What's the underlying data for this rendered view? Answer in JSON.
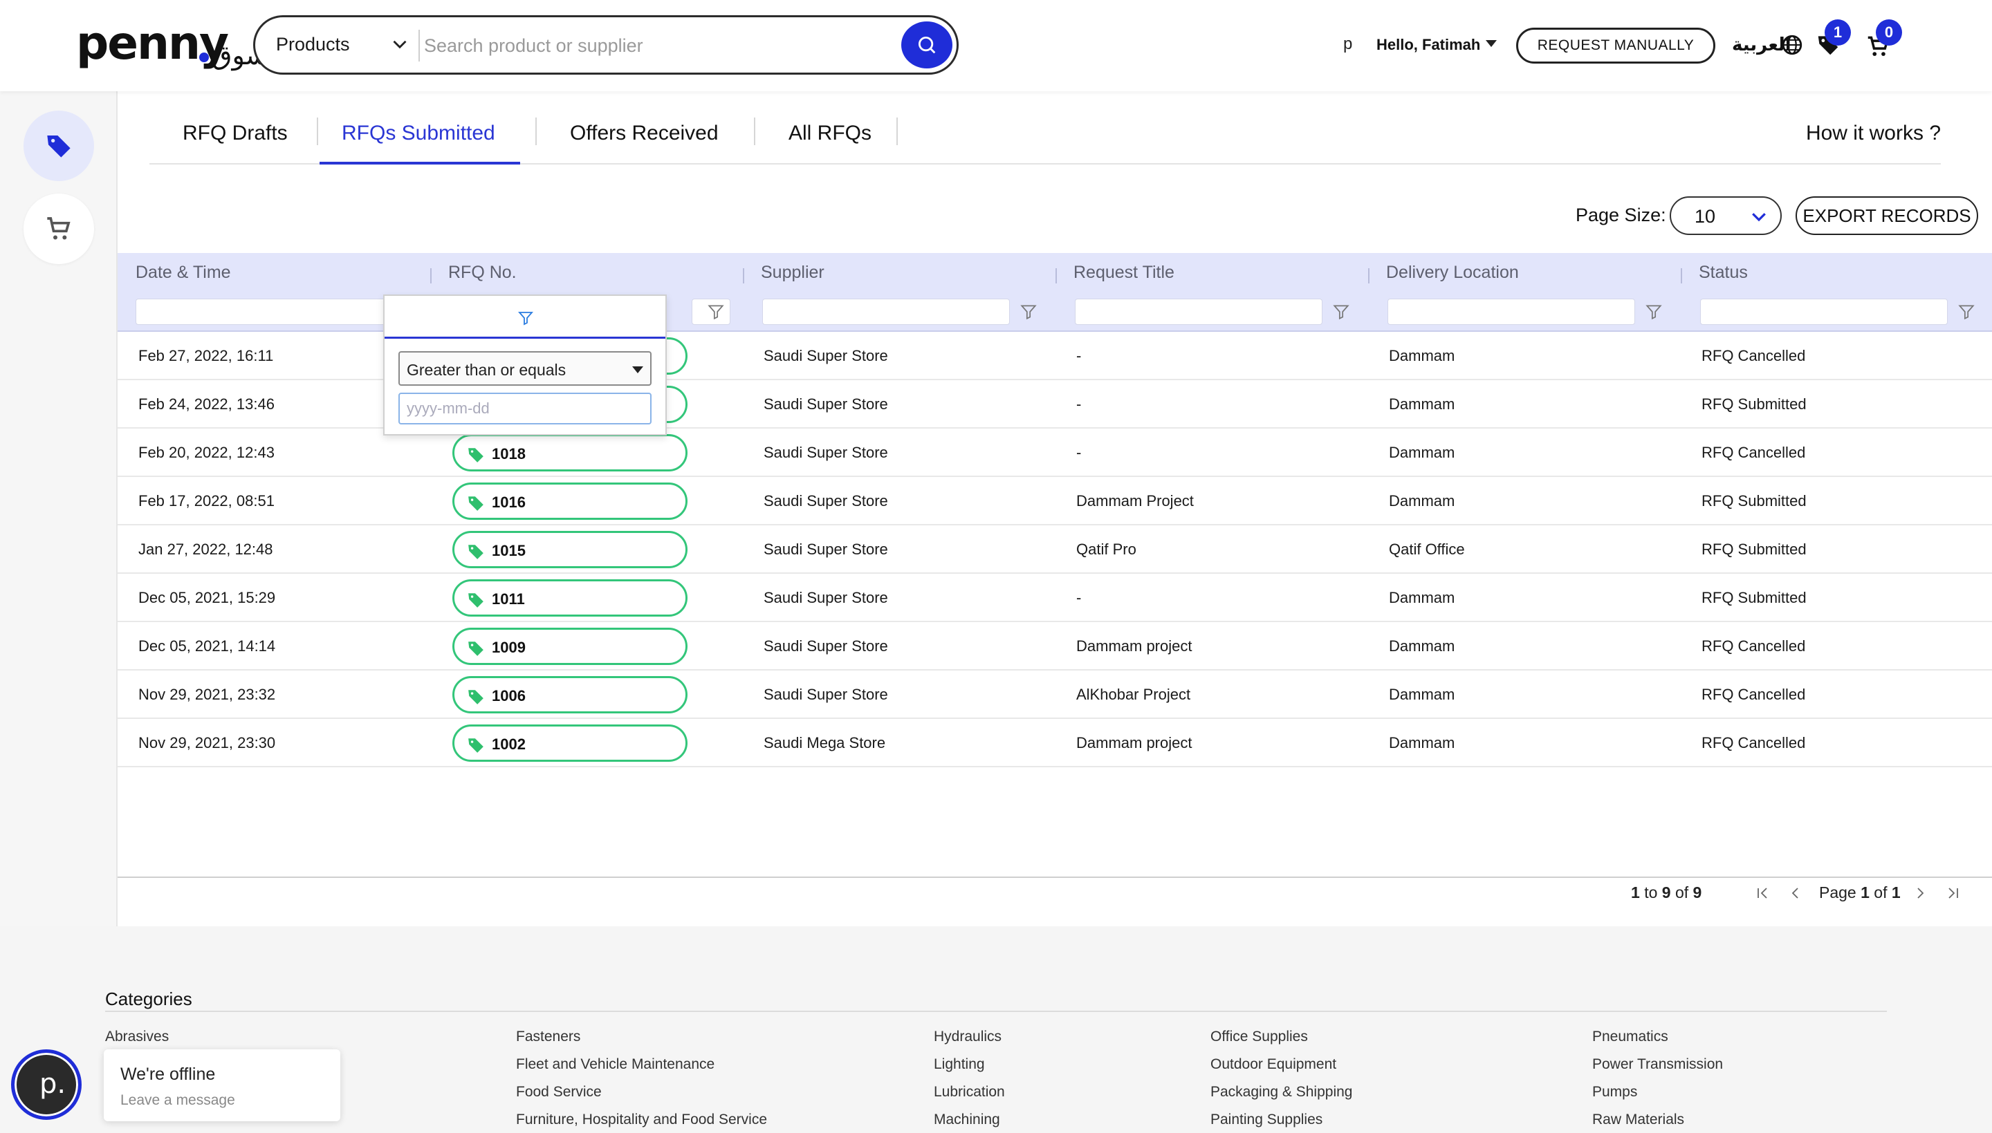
{
  "header": {
    "logo_text": "penny",
    "logo_arabic": "سوق",
    "search_category": "Products",
    "search_placeholder": "Search product or supplier",
    "user_initial": "p",
    "user_greeting": "Hello, Fatimah",
    "request_manually_label": "REQUEST MANUALLY",
    "language_label": "العربية",
    "favorites_count": "1",
    "cart_count": "0"
  },
  "tabs": {
    "items": [
      {
        "label": "RFQ Drafts"
      },
      {
        "label": "RFQs Submitted"
      },
      {
        "label": "Offers Received"
      },
      {
        "label": "All RFQs"
      }
    ],
    "active": "RFQs Submitted",
    "how_it_works": "How it works ?"
  },
  "toolbar": {
    "page_size_label": "Page Size:",
    "page_size_value": "10",
    "export_label": "EXPORT RECORDS"
  },
  "grid": {
    "columns": [
      "Date & Time",
      "RFQ No.",
      "Supplier",
      "Request Title",
      "Delivery Location",
      "Status"
    ],
    "rows": [
      {
        "date": "Feb 27, 2022, 16:11",
        "rfq": "",
        "supplier": "Saudi Super Store",
        "title": "-",
        "location": "Dammam",
        "status": "RFQ Cancelled"
      },
      {
        "date": "Feb 24, 2022, 13:46",
        "rfq": "",
        "supplier": "Saudi Super Store",
        "title": "-",
        "location": "Dammam",
        "status": "RFQ Submitted"
      },
      {
        "date": "Feb 20, 2022, 12:43",
        "rfq": "1018",
        "supplier": "Saudi Super Store",
        "title": "-",
        "location": "Dammam",
        "status": "RFQ Cancelled"
      },
      {
        "date": "Feb 17, 2022, 08:51",
        "rfq": "1016",
        "supplier": "Saudi Super Store",
        "title": "Dammam Project",
        "location": "Dammam",
        "status": "RFQ Submitted"
      },
      {
        "date": "Jan 27, 2022, 12:48",
        "rfq": "1015",
        "supplier": "Saudi Super Store",
        "title": "Qatif Pro",
        "location": "Qatif Office",
        "status": "RFQ Submitted"
      },
      {
        "date": "Dec 05, 2021, 15:29",
        "rfq": "1011",
        "supplier": "Saudi Super Store",
        "title": "-",
        "location": "Dammam",
        "status": "RFQ Submitted"
      },
      {
        "date": "Dec 05, 2021, 14:14",
        "rfq": "1009",
        "supplier": "Saudi Super Store",
        "title": "Dammam project",
        "location": "Dammam",
        "status": "RFQ Cancelled"
      },
      {
        "date": "Nov 29, 2021, 23:32",
        "rfq": "1006",
        "supplier": "Saudi Super Store",
        "title": "AlKhobar Project",
        "location": "Dammam",
        "status": "RFQ Cancelled"
      },
      {
        "date": "Nov 29, 2021, 23:30",
        "rfq": "1002",
        "supplier": "Saudi Mega Store",
        "title": "Dammam project",
        "location": "Dammam",
        "status": "RFQ Cancelled"
      }
    ],
    "filter_popup": {
      "operator": "Greater than or equals",
      "date_placeholder": "yyyy-mm-dd"
    }
  },
  "pagination": {
    "range_from": "1",
    "range_to": "9",
    "total": "9",
    "to_word": "to",
    "of_word": "of",
    "page_word": "Page",
    "current_page": "1",
    "total_pages": "1"
  },
  "footer": {
    "categories_title": "Categories",
    "columns": [
      [
        "Abrasives"
      ],
      [
        "Fasteners",
        "Fleet and Vehicle Maintenance",
        "Food Service",
        "Furniture, Hospitality and Food Service"
      ],
      [
        "Hydraulics",
        "Lighting",
        "Lubrication",
        "Machining"
      ],
      [
        "Office Supplies",
        "Outdoor Equipment",
        "Packaging & Shipping",
        "Painting Supplies"
      ],
      [
        "Pneumatics",
        "Power Transmission",
        "Pumps",
        "Raw Materials"
      ]
    ]
  },
  "chat": {
    "avatar_letter": "p.",
    "title": "We're offline",
    "subtitle": "Leave a message"
  },
  "colors": {
    "brand_blue": "#1f2dd8",
    "tab_active": "#2a36d4",
    "grid_header_bg": "#e2e5fb",
    "rfq_pill_border": "#33c67a",
    "rfq_tag_icon": "#2fbf6d"
  }
}
